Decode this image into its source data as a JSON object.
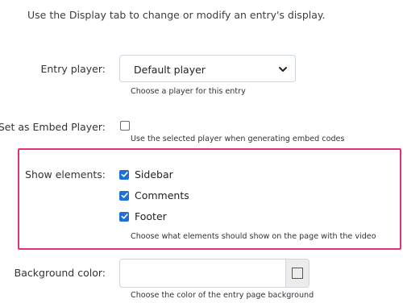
{
  "intro_text": "Use the Display tab to change or modify an entry's display.",
  "entry_player": {
    "label": "Entry player:",
    "selected": "Default player",
    "help": "Choose a player for this entry"
  },
  "embed_player": {
    "label": "Set as Embed Player:",
    "checked": false,
    "help": "Use the selected player when generating embed codes"
  },
  "show_elements": {
    "label": "Show elements:",
    "options": [
      {
        "label": "Sidebar",
        "checked": true
      },
      {
        "label": "Comments",
        "checked": true
      },
      {
        "label": "Footer",
        "checked": true
      }
    ],
    "help": "Choose what elements should show on the page with the video"
  },
  "background_color": {
    "label": "Background color:",
    "value": "",
    "help": "Choose the color of the entry page background"
  },
  "colors": {
    "highlight": "#e0317f",
    "checkbox_accent": "#1f6fd4"
  }
}
